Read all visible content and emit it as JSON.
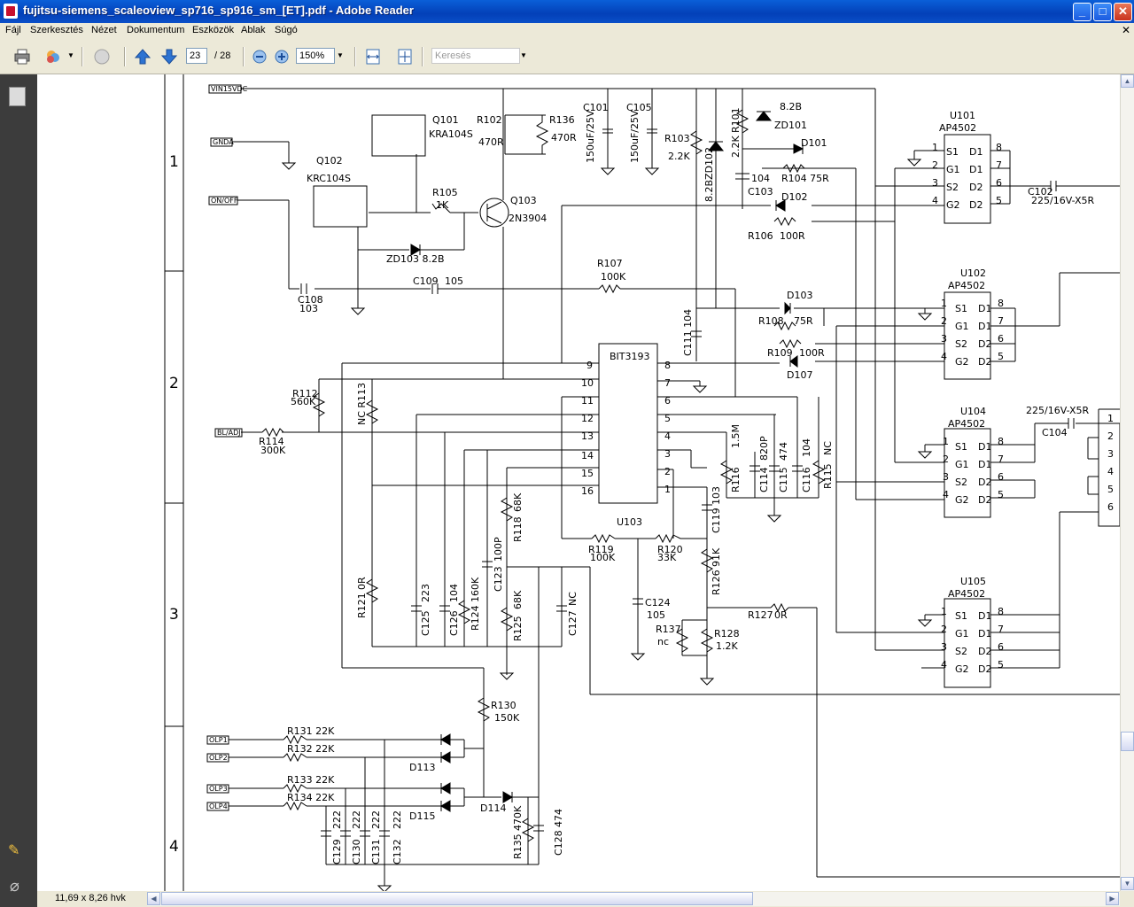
{
  "window": {
    "title": "fujitsu-siemens_scaleoview_sp716_sp916_sm_[ET].pdf - Adobe Reader",
    "buttons": {
      "minimize": "_",
      "maximize": "□",
      "close": "✕"
    }
  },
  "menu": [
    "Fájl",
    "Szerkesztés",
    "Nézet",
    "Dokumentum",
    "Eszközök",
    "Ablak",
    "Súgó"
  ],
  "toolbar": {
    "page_current": "23",
    "page_total": "/ 28",
    "zoom": "150%",
    "search_placeholder": "Keresés"
  },
  "status": {
    "page_size": "11,69 x 8,26 hvk"
  },
  "schematic": {
    "grid_rows": [
      "1",
      "2",
      "3",
      "4"
    ],
    "ports": [
      "VIN15VDC",
      "GNDA",
      "ON/OFF",
      "BL/ADJ",
      "OLP1",
      "OLP2",
      "OLP3",
      "OLP4"
    ],
    "ic_main": {
      "name": "BIT3193",
      "ref": "U103"
    },
    "mosfets": [
      {
        "ref": "U101",
        "type": "AP4502"
      },
      {
        "ref": "U102",
        "type": "AP4502"
      },
      {
        "ref": "U104",
        "type": "AP4502"
      },
      {
        "ref": "U105",
        "type": "AP4502"
      }
    ],
    "mosfet_pins_left": [
      "S1",
      "G1",
      "S2",
      "G2"
    ],
    "mosfet_pins_right": [
      "D1",
      "D1",
      "D2",
      "D2"
    ],
    "mosfet_pin_nums_left": [
      "1",
      "2",
      "3",
      "4"
    ],
    "mosfet_pin_nums_right": [
      "8",
      "7",
      "6",
      "5"
    ],
    "ic_pins_left": [
      "9",
      "10",
      "11",
      "12",
      "13",
      "14",
      "15",
      "16"
    ],
    "ic_pins_right": [
      "8",
      "7",
      "6",
      "5",
      "4",
      "3",
      "2",
      "1"
    ],
    "connector_pins": [
      "1",
      "2",
      "3",
      "4",
      "5",
      "6"
    ],
    "labels": {
      "q101": "Q101",
      "q101_type": "KRA104S",
      "q102": "Q102",
      "q102_type": "KRC104S",
      "q103": "Q103",
      "q103_type": "2N3904",
      "r102": "R102",
      "r102_val": "470R",
      "r136": "R136",
      "r136_val": "470R",
      "c101": "C101",
      "c101_val": "150uF/25V",
      "c105": "C105",
      "c105_val": "150uF/25V",
      "r103": "R103",
      "r103_val": "2.2K",
      "zd102": "8.2BZD102",
      "r101": "R101",
      "r101_val": "2.2K",
      "zd101_val": "8.2B",
      "zd101": "ZD101",
      "d101": "D101",
      "r104": "R104 75R",
      "c103_val": "104",
      "c103": "C103",
      "d102": "D102",
      "r106": "R106",
      "r106_val": "100R",
      "r105": "R105",
      "r105_val": "1K",
      "zd103": "ZD103 8.2B",
      "c102": "C102",
      "c102_val": "225/16V-X5R",
      "c108": "C108",
      "c108_val": "103",
      "c109": "C109",
      "c109_val": "105",
      "r107": "R107",
      "r107_val": "100K",
      "c111": "C111 104",
      "d103": "D103",
      "r108": "R108",
      "r108_val": "75R",
      "r109": "R109",
      "r109_val": "100R",
      "d107": "D107",
      "r112": "R112",
      "r112_val": "560K",
      "r113": "NC R113",
      "r114": "R114",
      "r114_val": "300K",
      "r116": "R116",
      "r116_val": "1.5M",
      "c114": "C114",
      "c114_val": "820P",
      "c115": "C115",
      "c115_val": "474",
      "c116": "C116",
      "c116_val": "104",
      "r115": "R115",
      "r115_val": "NC",
      "c119": "C119",
      "c119_val": "103",
      "r118": "R118",
      "r118_val": "68K",
      "c123": "C123",
      "c123_val": "100P",
      "r119": "R119",
      "r119_val": "100K",
      "r120": "R120",
      "r120_val": "33K",
      "r121": "R121",
      "r121_val": "0R",
      "c125": "C125",
      "c125_val": "223",
      "c126": "C126",
      "c126_val": "104",
      "r124": "R124",
      "r124_val": "160K",
      "r125": "R125",
      "r125_val": "68K",
      "c127": "C127",
      "c127_val": "NC",
      "c124": "C124",
      "c124_val": "105",
      "r126": "R126",
      "r126_val": "91K",
      "r127": "R127",
      "r127_val": "0R",
      "r137": "R137",
      "r137_val": "nc",
      "r128": "R128",
      "r128_val": "1.2K",
      "c104_val": "225/16V-X5R",
      "c104": "C104",
      "r130": "R130",
      "r130_val": "150K",
      "r131": "R131 22K",
      "r132": "R132 22K",
      "r133": "R133 22K",
      "r134": "R134 22K",
      "d113": "D113",
      "d114": "D114",
      "d115": "D115",
      "r135": "R135",
      "r135_val": "470K",
      "c128": "C128",
      "c128_val": "474",
      "c129": "C129",
      "c129_val": "222",
      "c130": "C130",
      "c130_val": "222",
      "c131": "C131",
      "c131_val": "222",
      "c132": "C132",
      "c132_val": "222"
    }
  }
}
